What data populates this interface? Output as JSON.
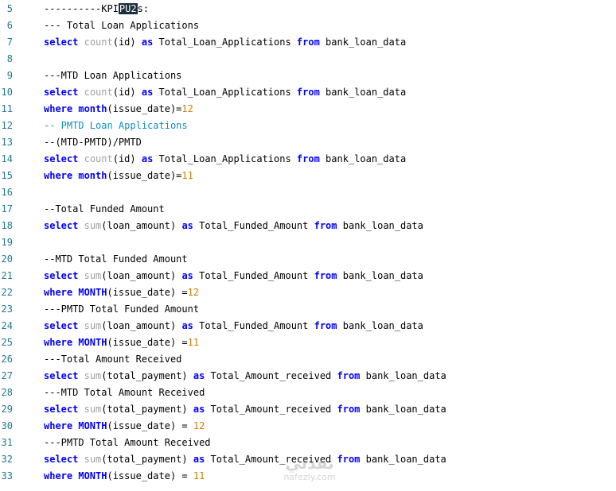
{
  "editor": {
    "lines": [
      {
        "num": "5",
        "tokens": [
          {
            "t": "----------KPI",
            "c": ""
          },
          {
            "t": "PU2",
            "c": "hl"
          },
          {
            "t": "s:",
            "c": ""
          }
        ]
      },
      {
        "num": "6",
        "tokens": [
          {
            "t": "--- Total Loan Applications",
            "c": ""
          }
        ]
      },
      {
        "num": "7",
        "tokens": [
          {
            "t": "select",
            "c": "kw"
          },
          {
            "t": " ",
            "c": ""
          },
          {
            "t": "count",
            "c": "fn"
          },
          {
            "t": "(id) ",
            "c": ""
          },
          {
            "t": "as",
            "c": "kw"
          },
          {
            "t": " Total_Loan_Applications ",
            "c": ""
          },
          {
            "t": "from",
            "c": "kw"
          },
          {
            "t": " bank_loan_data",
            "c": ""
          }
        ]
      },
      {
        "num": "8",
        "tokens": []
      },
      {
        "num": "9",
        "tokens": [
          {
            "t": "---MTD Loan Applications",
            "c": ""
          }
        ]
      },
      {
        "num": "10",
        "tokens": [
          {
            "t": "select",
            "c": "kw"
          },
          {
            "t": " ",
            "c": ""
          },
          {
            "t": "count",
            "c": "fn"
          },
          {
            "t": "(id) ",
            "c": ""
          },
          {
            "t": "as",
            "c": "kw"
          },
          {
            "t": " Total_Loan_Applications ",
            "c": ""
          },
          {
            "t": "from",
            "c": "kw"
          },
          {
            "t": " bank_loan_data",
            "c": ""
          }
        ]
      },
      {
        "num": "11",
        "tokens": [
          {
            "t": "where",
            "c": "kw"
          },
          {
            "t": " ",
            "c": ""
          },
          {
            "t": "month",
            "c": "fk"
          },
          {
            "t": "(issue_date)=",
            "c": ""
          },
          {
            "t": "12",
            "c": "num"
          }
        ]
      },
      {
        "num": "12",
        "tokens": [
          {
            "t": "-- PMTD Loan Applications",
            "c": "cm2"
          }
        ]
      },
      {
        "num": "13",
        "tokens": [
          {
            "t": "--(MTD-PMTD)/PMTD",
            "c": ""
          }
        ]
      },
      {
        "num": "14",
        "tokens": [
          {
            "t": "select",
            "c": "kw"
          },
          {
            "t": " ",
            "c": ""
          },
          {
            "t": "count",
            "c": "fn"
          },
          {
            "t": "(id) ",
            "c": ""
          },
          {
            "t": "as",
            "c": "kw"
          },
          {
            "t": " Total_Loan_Applications ",
            "c": ""
          },
          {
            "t": "from",
            "c": "kw"
          },
          {
            "t": " bank_loan_data",
            "c": ""
          }
        ]
      },
      {
        "num": "15",
        "tokens": [
          {
            "t": "where",
            "c": "kw"
          },
          {
            "t": " ",
            "c": ""
          },
          {
            "t": "month",
            "c": "fk"
          },
          {
            "t": "(issue_date)=",
            "c": ""
          },
          {
            "t": "11",
            "c": "num"
          }
        ]
      },
      {
        "num": "16",
        "tokens": []
      },
      {
        "num": "17",
        "tokens": [
          {
            "t": "--Total Funded Amount",
            "c": ""
          }
        ]
      },
      {
        "num": "18",
        "tokens": [
          {
            "t": "select",
            "c": "kw"
          },
          {
            "t": " ",
            "c": ""
          },
          {
            "t": "sum",
            "c": "fn"
          },
          {
            "t": "(loan_amount) ",
            "c": ""
          },
          {
            "t": "as",
            "c": "kw"
          },
          {
            "t": " Total_Funded_Amount ",
            "c": ""
          },
          {
            "t": "from",
            "c": "kw"
          },
          {
            "t": " bank_loan_data",
            "c": ""
          }
        ]
      },
      {
        "num": "19",
        "tokens": []
      },
      {
        "num": "20",
        "tokens": [
          {
            "t": "--MTD Total Funded Amount",
            "c": ""
          }
        ]
      },
      {
        "num": "21",
        "tokens": [
          {
            "t": "select",
            "c": "kw"
          },
          {
            "t": " ",
            "c": ""
          },
          {
            "t": "sum",
            "c": "fn"
          },
          {
            "t": "(loan_amount) ",
            "c": ""
          },
          {
            "t": "as",
            "c": "kw"
          },
          {
            "t": " Total_Funded_Amount ",
            "c": ""
          },
          {
            "t": "from",
            "c": "kw"
          },
          {
            "t": " bank_loan_data",
            "c": ""
          }
        ]
      },
      {
        "num": "22",
        "tokens": [
          {
            "t": "where",
            "c": "kw"
          },
          {
            "t": " ",
            "c": ""
          },
          {
            "t": "MONTH",
            "c": "fk"
          },
          {
            "t": "(issue_date) =",
            "c": ""
          },
          {
            "t": "12",
            "c": "num"
          }
        ]
      },
      {
        "num": "23",
        "tokens": [
          {
            "t": "---PMTD Total Funded Amount",
            "c": ""
          }
        ]
      },
      {
        "num": "24",
        "tokens": [
          {
            "t": "select",
            "c": "kw"
          },
          {
            "t": " ",
            "c": ""
          },
          {
            "t": "sum",
            "c": "fn"
          },
          {
            "t": "(loan_amount) ",
            "c": ""
          },
          {
            "t": "as",
            "c": "kw"
          },
          {
            "t": " Total_Funded_Amount ",
            "c": ""
          },
          {
            "t": "from",
            "c": "kw"
          },
          {
            "t": " bank_loan_data",
            "c": ""
          }
        ]
      },
      {
        "num": "25",
        "tokens": [
          {
            "t": "where",
            "c": "kw"
          },
          {
            "t": " ",
            "c": ""
          },
          {
            "t": "MONTH",
            "c": "fk"
          },
          {
            "t": "(issue_date) =",
            "c": ""
          },
          {
            "t": "11",
            "c": "num"
          }
        ]
      },
      {
        "num": "26",
        "tokens": [
          {
            "t": "---Total Amount Received",
            "c": ""
          }
        ]
      },
      {
        "num": "27",
        "tokens": [
          {
            "t": "select",
            "c": "kw"
          },
          {
            "t": " ",
            "c": ""
          },
          {
            "t": "sum",
            "c": "fn"
          },
          {
            "t": "(total_payment) ",
            "c": ""
          },
          {
            "t": "as",
            "c": "kw"
          },
          {
            "t": " Total_Amount_received ",
            "c": ""
          },
          {
            "t": "from",
            "c": "kw"
          },
          {
            "t": " bank_loan_data",
            "c": ""
          }
        ]
      },
      {
        "num": "28",
        "tokens": [
          {
            "t": "---MTD Total Amount Received",
            "c": ""
          }
        ]
      },
      {
        "num": "29",
        "tokens": [
          {
            "t": "select",
            "c": "kw"
          },
          {
            "t": " ",
            "c": ""
          },
          {
            "t": "sum",
            "c": "fn"
          },
          {
            "t": "(total_payment) ",
            "c": ""
          },
          {
            "t": "as",
            "c": "kw"
          },
          {
            "t": " Total_Amount_received ",
            "c": ""
          },
          {
            "t": "from",
            "c": "kw"
          },
          {
            "t": " bank_loan_data",
            "c": ""
          }
        ]
      },
      {
        "num": "30",
        "tokens": [
          {
            "t": "where",
            "c": "kw"
          },
          {
            "t": " ",
            "c": ""
          },
          {
            "t": "MONTH",
            "c": "fk"
          },
          {
            "t": "(issue_date) = ",
            "c": ""
          },
          {
            "t": "12",
            "c": "num"
          }
        ]
      },
      {
        "num": "31",
        "tokens": [
          {
            "t": "---PMTD Total Amount Received",
            "c": ""
          }
        ]
      },
      {
        "num": "32",
        "tokens": [
          {
            "t": "select",
            "c": "kw"
          },
          {
            "t": " ",
            "c": ""
          },
          {
            "t": "sum",
            "c": "fn"
          },
          {
            "t": "(total_payment) ",
            "c": ""
          },
          {
            "t": "as",
            "c": "kw"
          },
          {
            "t": " Total_Amount_received ",
            "c": ""
          },
          {
            "t": "from",
            "c": "kw"
          },
          {
            "t": " bank_loan_data",
            "c": ""
          }
        ]
      },
      {
        "num": "33",
        "tokens": [
          {
            "t": "where",
            "c": "kw"
          },
          {
            "t": " ",
            "c": ""
          },
          {
            "t": "MONTH",
            "c": "fk"
          },
          {
            "t": "(issue_date) = ",
            "c": ""
          },
          {
            "t": "11",
            "c": "num"
          }
        ]
      }
    ]
  },
  "watermark": {
    "logo_text": "نفذلي",
    "site_text": "nafezly.com"
  }
}
